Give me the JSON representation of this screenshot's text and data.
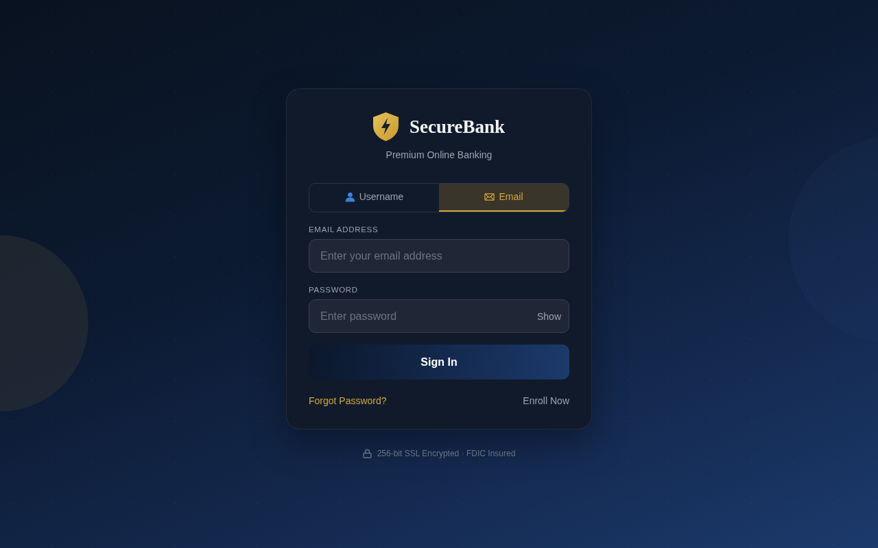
{
  "brand": {
    "name": "SecureBank",
    "tagline": "Premium Online Banking"
  },
  "tabs": [
    {
      "kind": "user",
      "label": "Username",
      "selected": false
    },
    {
      "kind": "mail",
      "label": "Email",
      "selected": true
    }
  ],
  "fields": [
    {
      "label": "EMAIL ADDRESS",
      "placeholder": "Enter your email address"
    },
    {
      "label": "PASSWORD",
      "placeholder": "Enter password",
      "toggle": "Show"
    }
  ],
  "submit": "Sign In",
  "links": [
    {
      "kind": "accent",
      "label": "Forgot Password?"
    },
    {
      "kind": "muted",
      "label": "Enroll Now"
    }
  ],
  "footer": "256-bit SSL Encrypted · FDIC Insured"
}
